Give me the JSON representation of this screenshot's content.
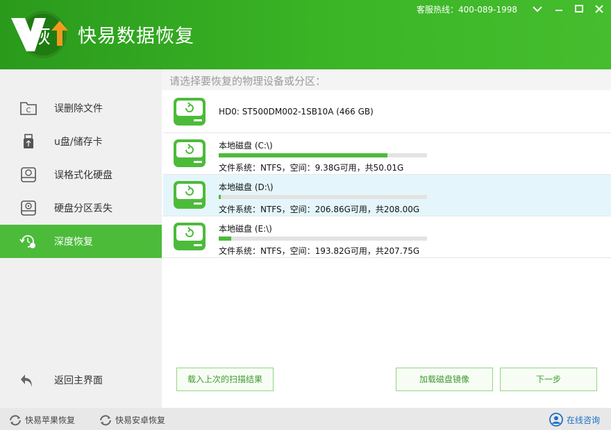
{
  "header": {
    "logo_char": "恢",
    "app_title": "快易数据恢复",
    "hotline": "客服热线：400-089-1998"
  },
  "sidebar": {
    "items": [
      {
        "label": "误删除文件",
        "icon": "folder-recover-icon",
        "active": false
      },
      {
        "label": "u盘/储存卡",
        "icon": "usb-drive-icon",
        "active": false
      },
      {
        "label": "误格式化硬盘",
        "icon": "disk-format-icon",
        "active": false
      },
      {
        "label": "硬盘分区丢失",
        "icon": "partition-lost-icon",
        "active": false
      },
      {
        "label": "深度恢复",
        "icon": "deep-recovery-icon",
        "active": true
      }
    ],
    "back_label": "返回主界面"
  },
  "main": {
    "prompt": "请选择要恢复的物理设备或分区：",
    "disks": [
      {
        "name": "HD0: ST500DM002-1SB10A (466 GB)",
        "type": "physical"
      },
      {
        "name": "本地磁盘 (C:\\)",
        "used_fraction": 0.81,
        "info": "文件系统：NTFS，空间：9.38G可用，共50.01G",
        "selected": false
      },
      {
        "name": "本地磁盘 (D:\\)",
        "used_fraction": 0.01,
        "info": "文件系统：NTFS，空间：206.86G可用，共208.00G",
        "selected": true
      },
      {
        "name": "本地磁盘 (E:\\)",
        "used_fraction": 0.06,
        "info": "文件系统：NTFS，空间：193.82G可用，共207.75G",
        "selected": false
      }
    ],
    "buttons": {
      "load_last": "载入上次的扫描结果",
      "load_image": "加载磁盘镜像",
      "next": "下一步"
    }
  },
  "footer": {
    "apple_recovery": "快易苹果恢复",
    "android_recovery": "快易安卓恢复",
    "online_consult": "在线咨询"
  },
  "colors": {
    "brand_green": "#3bb526",
    "active_green": "#4cbb3a",
    "selected_row": "#e4f6fb",
    "link_blue": "#1d6fc6"
  }
}
